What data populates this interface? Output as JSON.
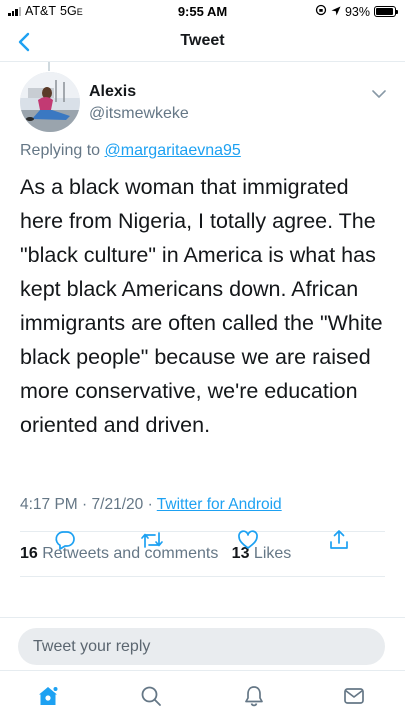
{
  "status_bar": {
    "carrier": "AT&T",
    "network": "5G",
    "network_suffix": "E",
    "time": "9:55 AM",
    "battery": "93%",
    "battery_level": 0.93
  },
  "nav": {
    "title": "Tweet",
    "back_icon": "chevron-left-icon"
  },
  "tweet": {
    "author_name": "Alexis",
    "author_handle": "@itsmewkeke",
    "replying_prefix": "Replying to",
    "replying_to": "@margaritaevna95",
    "text": "As a black woman that immigrated here from Nigeria, I totally agree. The \"black culture\" in America is what has kept black Americans down. African immigrants are often called the \"White black people\" because we are raised more conservative, we're education oriented and driven.",
    "time": "4:17 PM",
    "sep1": "·",
    "date": "7/21/20",
    "sep2": "·",
    "source": "Twitter for Android"
  },
  "stats": {
    "retweets_count": "16",
    "retweets_label": "Retweets and comments",
    "likes_count": "13",
    "likes_label": "Likes"
  },
  "actions": [
    "reply-icon",
    "retweet-icon",
    "like-icon",
    "share-icon"
  ],
  "reply": {
    "placeholder": "Tweet your reply"
  },
  "tabs": [
    "home-icon",
    "search-icon",
    "notifications-icon",
    "messages-icon"
  ],
  "colors": {
    "accent": "#1da1f2",
    "text": "#14171a",
    "muted": "#657786",
    "border": "#e6ecf0",
    "input_bg": "#e9ecef"
  }
}
